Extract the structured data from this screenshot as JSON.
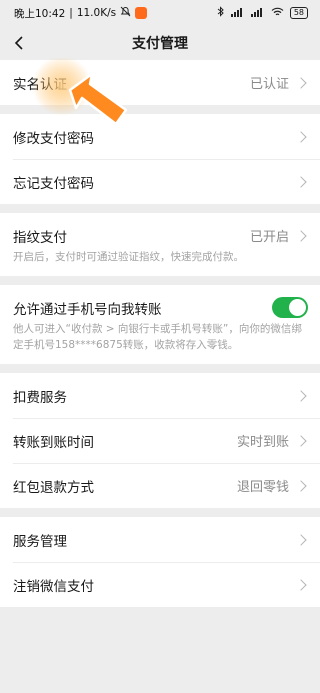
{
  "status": {
    "time": "晚上10:42",
    "speed": "11.0K/s",
    "battery": "58"
  },
  "nav": {
    "title": "支付管理"
  },
  "sections": {
    "identity": {
      "label": "实名认证",
      "value": "已认证"
    },
    "change_pwd": {
      "label": "修改支付密码"
    },
    "forgot_pwd": {
      "label": "忘记支付密码"
    },
    "fingerprint": {
      "label": "指纹支付",
      "value": "已开启",
      "desc": "开启后，支付时可通过验证指纹，快速完成付款。"
    },
    "phone_transfer": {
      "label": "允许通过手机号向我转账",
      "desc": "他人可进入“收付款 > 向银行卡或手机号转账”，向你的微信绑定手机号158****6875转账，收款将存入零钱。",
      "enabled": true
    },
    "deduction": {
      "label": "扣费服务"
    },
    "transfer_time": {
      "label": "转账到账时间",
      "value": "实时到账"
    },
    "redpacket_refund": {
      "label": "红包退款方式",
      "value": "退回零钱"
    },
    "service_mgmt": {
      "label": "服务管理"
    },
    "cancel_pay": {
      "label": "注销微信支付"
    }
  },
  "colors": {
    "toggle_on": "#22b24c",
    "pointer": "#ff8a1f",
    "background": "#ededed"
  },
  "icons": [
    "back-arrow-icon",
    "chevron-right-icon",
    "bluetooth-icon",
    "signal-icon",
    "wifi-icon",
    "battery-icon",
    "pointer-arrow-icon"
  ]
}
